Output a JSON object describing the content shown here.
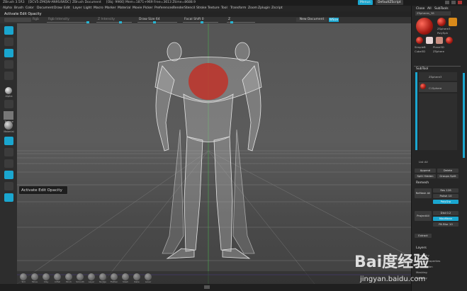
{
  "titlebar": {
    "app": "ZBrush 3.5R3",
    "session": "[DCV5-ZMQW-AN9S4WDC]",
    "document": "ZBrush Document",
    "stats": "[Obj: 9966] Mem=1871+969 Free=3613 Ztime=8688.9",
    "menus_btn": "Menus",
    "ui_btn": "DefaultZScript"
  },
  "menubar": {
    "items": [
      "Alpha",
      "Brush",
      "Color",
      "Document",
      "Draw",
      "Edit",
      "Layer",
      "Light",
      "Macro",
      "Marker",
      "Material",
      "Movie",
      "Picker",
      "Preferences",
      "Render",
      "Stencil",
      "Stroke",
      "Texture",
      "Tool",
      "Transform",
      "Zoom",
      "Zplugin",
      "Zscript"
    ]
  },
  "toolheader": {
    "title": "Activate Edit Opacity"
  },
  "topshelf": {
    "draw_size_label": "Draw Size 64",
    "focal_shift_label": "Focal Shift 0",
    "z_label": "Z",
    "rgb_label": "Rgb",
    "rgb_intensity_label": "Rgb Intensity",
    "z_intensity_label": "Z Intensity",
    "new_document": "New Document",
    "wsize": "WSize"
  },
  "leftshelf": {
    "labels": [
      "Alpha",
      "Texture",
      "Material"
    ]
  },
  "tooltip": {
    "text": "Activate Edit Opacity"
  },
  "bottomshelf": {
    "items": [
      "Std",
      "Move",
      "Clay",
      "Inflat",
      "Pinch",
      "Smooth",
      "Layer",
      "Nudge",
      "Flatten",
      "Slash",
      "Rake",
      "Laver"
    ]
  },
  "righttray": {
    "header_close": "Close",
    "header_all": "All",
    "header_subtools": "SubTools",
    "tool_name": "ZSpheres_38",
    "tool_labels": [
      "ZSphere3",
      "PolySph",
      "SimpleB",
      "Plane3D",
      "Cube3D",
      "ZSphere"
    ],
    "subtool_title": "SubTool",
    "subtool_items": [
      "ZSphere3",
      "Cl.Sphere"
    ],
    "list_all": "List All",
    "append": "Append",
    "delete": "Delete",
    "split_hidden": "Split Hidden",
    "groups_split": "Groups Split",
    "remesh_title": "Remesh",
    "remesh_all": "ReMesh All",
    "res": "Res 128",
    "polish": "Polish 10",
    "polygroup": "PolyGrp",
    "project_all": "ProjectAll",
    "dist": "Dist 0.2",
    "maxmean": "MaxMean",
    "pa_blur": "PA Blur 10",
    "extract": "Extract",
    "layers_title": "Layers",
    "geometry": "Geometry",
    "display": "Display Properties",
    "deformation": "Deformation",
    "masking": "Masking",
    "visibility": "Visibility"
  },
  "watermark": {
    "brand": "Bai度经验",
    "url": "jingyan.baidu.com"
  }
}
